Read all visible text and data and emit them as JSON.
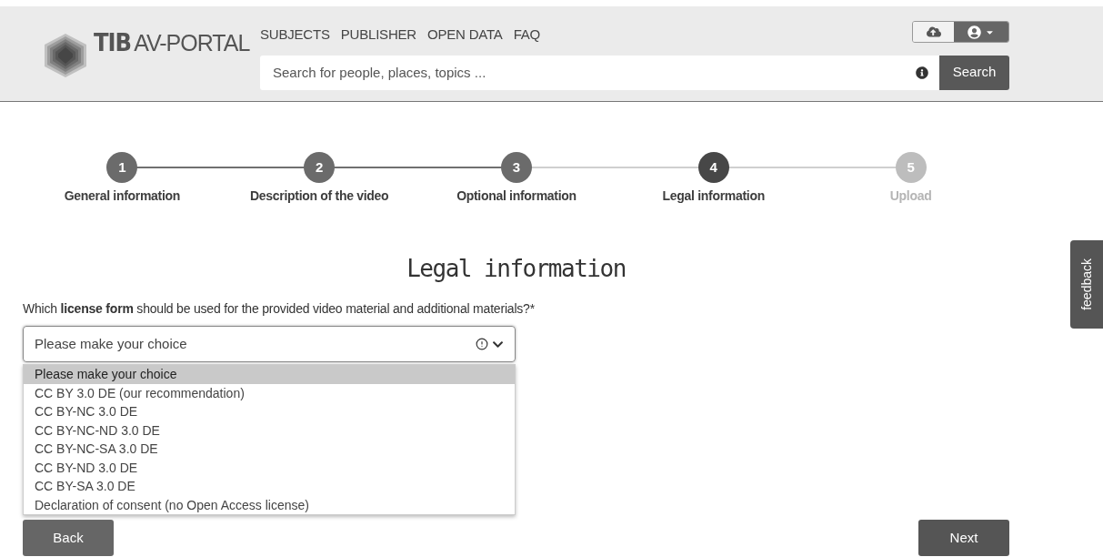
{
  "header": {
    "logo_bold": "TIB",
    "logo_text": "AV-PORTAL",
    "nav": [
      "SUBJECTS",
      "PUBLISHER",
      "OPEN DATA",
      "FAQ"
    ],
    "search": {
      "placeholder": "Search for people, places, topics ...",
      "button": "Search"
    }
  },
  "steps": [
    {
      "number": "1",
      "label": "General information",
      "kind": "done"
    },
    {
      "number": "2",
      "label": "Description of the video",
      "kind": "done"
    },
    {
      "number": "3",
      "label": "Optional information",
      "kind": "done"
    },
    {
      "number": "4",
      "label": "Legal information",
      "kind": "current"
    },
    {
      "number": "5",
      "label": "Upload",
      "kind": "todo"
    }
  ],
  "title": "Legal information",
  "question": "Which **license form** should be used for the provided video material and additional materials?*",
  "select": {
    "value": "Please make your choice",
    "expanded": true,
    "options": [
      {
        "label": "Please make your choice",
        "selected": true
      },
      {
        "label": "CC BY 3.0 DE (our recommendation)",
        "selected": false
      },
      {
        "label": "CC BY-NC 3.0 DE",
        "selected": false
      },
      {
        "label": "CC BY-NC-ND 3.0 DE",
        "selected": false
      },
      {
        "label": "CC BY-NC-SA 3.0 DE",
        "selected": false
      },
      {
        "label": "CC BY-ND 3.0 DE",
        "selected": false
      },
      {
        "label": "CC BY-SA 3.0 DE",
        "selected": false
      },
      {
        "label": "Declaration of consent (no Open Access license)",
        "selected": false
      }
    ]
  },
  "buttons": {
    "back": "Back",
    "next": "Next"
  },
  "feedback": "feedback"
}
